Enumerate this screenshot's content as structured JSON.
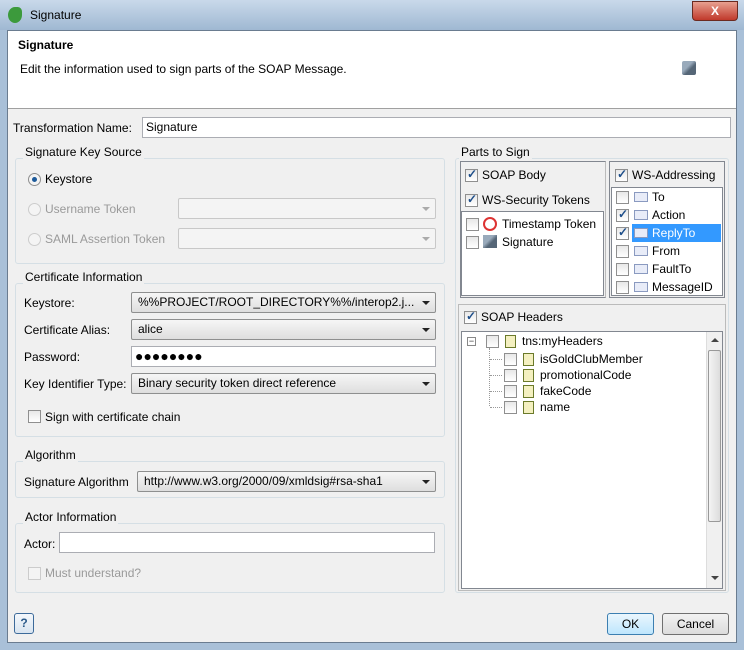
{
  "window": {
    "title": "Signature",
    "close_label": "X"
  },
  "header": {
    "title": "Signature",
    "description": "Edit the information used to sign parts of the SOAP Message."
  },
  "transformation": {
    "label": "Transformation Name:",
    "value": "Signature"
  },
  "key_source": {
    "title": "Signature Key Source",
    "keystore": "Keystore",
    "username": "Username Token",
    "saml": "SAML Assertion Token",
    "selected": "Keystore"
  },
  "certificate": {
    "title": "Certificate Information",
    "keystore_label": "Keystore:",
    "keystore_value": "%%PROJECT/ROOT_DIRECTORY%%/interop2.j...",
    "alias_label": "Certificate Alias:",
    "alias_value": "alice",
    "password_label": "Password:",
    "password_value": "●●●●●●●●",
    "keyid_label": "Key Identifier Type:",
    "keyid_value": "Binary security token direct reference",
    "chain_label": "Sign with certificate chain",
    "chain_checked": false
  },
  "algorithm": {
    "title": "Algorithm",
    "label": "Signature Algorithm",
    "value": "http://www.w3.org/2000/09/xmldsig#rsa-sha1"
  },
  "actor": {
    "title": "Actor Information",
    "label": "Actor:",
    "value": "",
    "must_understand": "Must understand?"
  },
  "parts": {
    "title": "Parts to Sign",
    "soap_body": "SOAP Body",
    "ws_security": "WS-Security Tokens",
    "tokens": [
      {
        "label": "Timestamp Token",
        "checked": false
      },
      {
        "label": "Signature",
        "checked": false
      }
    ],
    "ws_addressing": "WS-Addressing",
    "addressing": [
      {
        "label": "To",
        "checked": false
      },
      {
        "label": "Action",
        "checked": true
      },
      {
        "label": "ReplyTo",
        "checked": true,
        "selected": true
      },
      {
        "label": "From",
        "checked": false
      },
      {
        "label": "FaultTo",
        "checked": false
      },
      {
        "label": "MessageID",
        "checked": false
      }
    ],
    "soap_headers": "SOAP Headers",
    "tree_root": "tns:myHeaders",
    "tree_children": [
      "isGoldClubMember",
      "promotionalCode",
      "fakeCode",
      "name"
    ]
  },
  "footer": {
    "help": "?",
    "ok": "OK",
    "cancel": "Cancel"
  }
}
